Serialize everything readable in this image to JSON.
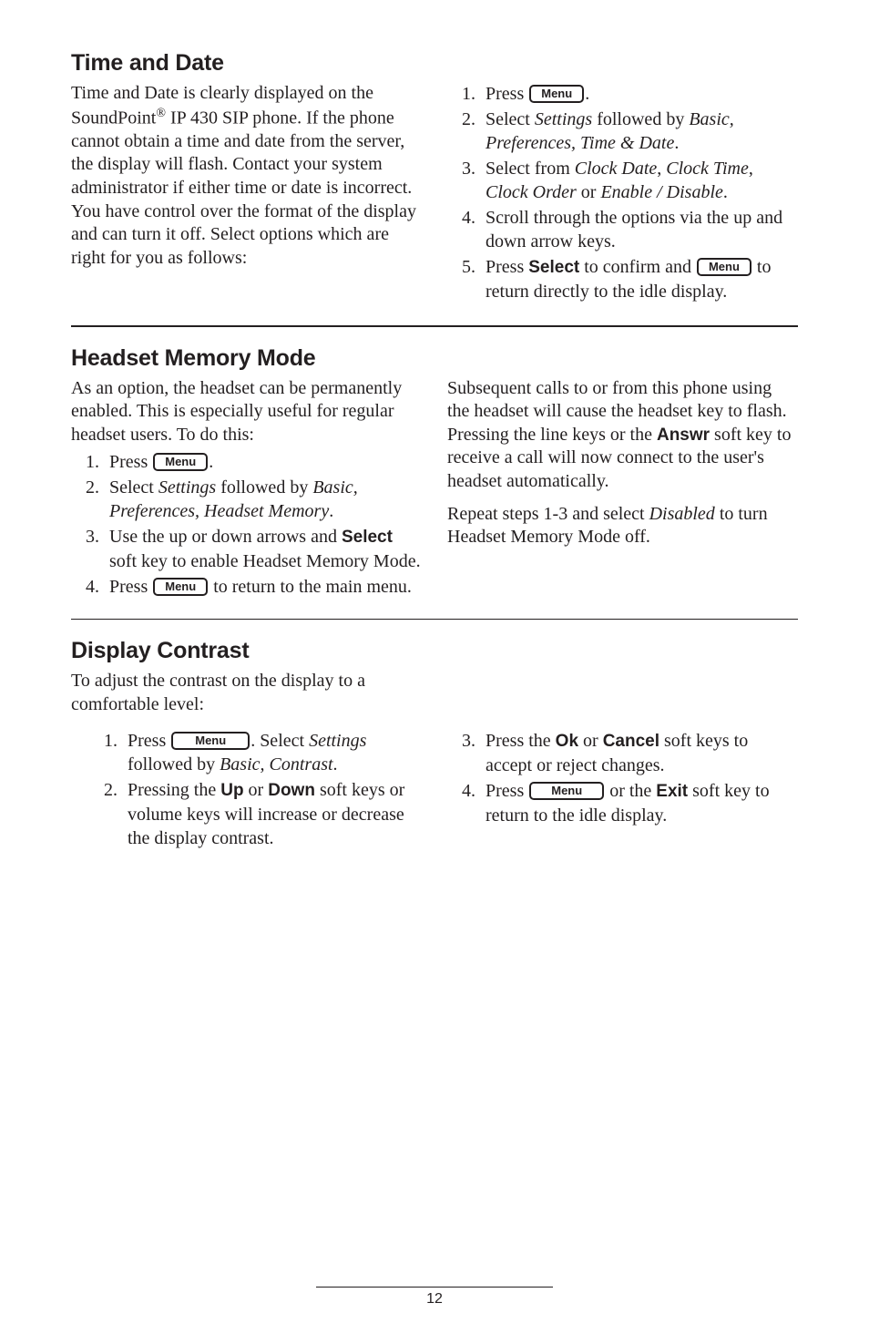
{
  "menu_label": "Menu",
  "page_number": "12",
  "section1": {
    "heading": "Time and Date",
    "intro": "Time and Date is clearly displayed on the SoundPoint® IP 430 SIP phone.  If the phone cannot obtain a time and date from the server, the display will flash.  Contact your system administrator if either time or date is incorrect.  You have control over the format of the display and can turn it off.  Select options which are right for you as follows:",
    "s1_press": "Press ",
    "s1_period": ".",
    "s2_a": "Select ",
    "s2_settings": "Settings",
    "s2_b": " followed by ",
    "s2_basic": "Basic, Preferences, Time & Date",
    "s2_c": ".",
    "s3_a": "Select from ",
    "s3_cd": "Clock Date",
    "s3_comma": ", ",
    "s3_ct": "Clock Time",
    "s3_comma2": ", ",
    "s3_co": "Clock Order",
    "s3_or": " or ",
    "s3_ed": "Enable / Disable",
    "s3_period": ".",
    "s4": "Scroll through the options via the up and down arrow keys.",
    "s5_a": "Press ",
    "s5_select": "Select",
    "s5_b": " to confirm and ",
    "s5_c": " to return directly to the idle display."
  },
  "section2": {
    "heading": "Headset Memory Mode",
    "intro": "As an option, the headset can be permanently enabled.  This is especially useful for regular headset users.  To do this:",
    "s1_press": "Press ",
    "s1_period": ".",
    "s2_a": "Select ",
    "s2_settings": "Settings",
    "s2_b": " followed by ",
    "s2_basic": "Basic, Preferences, Headset Memory",
    "s2_c": ".",
    "s3_a": "Use the up or down arrows and ",
    "s3_select": "Select",
    "s3_b": " soft key to enable Headset Memory Mode.",
    "s4_a": "Press ",
    "s4_b": " to return to the main menu.",
    "right_a": "Subsequent calls to or from this phone using the headset will cause the headset key to flash.  Pressing the line keys or the ",
    "right_answr": "Answr",
    "right_b": " soft key to receive a call will now connect to the user's headset automatically.",
    "right2_a": "Repeat steps 1-3 and select ",
    "right2_disabled": "Disabled",
    "right2_b": " to turn Headset Memory Mode off."
  },
  "section3": {
    "heading": "Display Contrast",
    "intro": "To adjust the contrast on the display to a comfortable level:",
    "s1_a": "Press ",
    "s1_b": ".  Select ",
    "s1_settings": "Settings",
    "s1_c": " followed by ",
    "s1_basic": "Basic, Contrast",
    "s1_d": ".",
    "s2_a": "Pressing the ",
    "s2_up": "Up",
    "s2_or": " or ",
    "s2_down": "Down",
    "s2_b": " soft keys or volume keys will increase or decrease the display contrast.",
    "s3_a": "Press the ",
    "s3_ok": "Ok",
    "s3_or": " or ",
    "s3_cancel": "Cancel",
    "s3_b": " soft keys to accept or reject changes.",
    "s4_a": "Press ",
    "s4_b": " or the ",
    "s4_exit": "Exit",
    "s4_c": " soft key to return to the idle display."
  }
}
